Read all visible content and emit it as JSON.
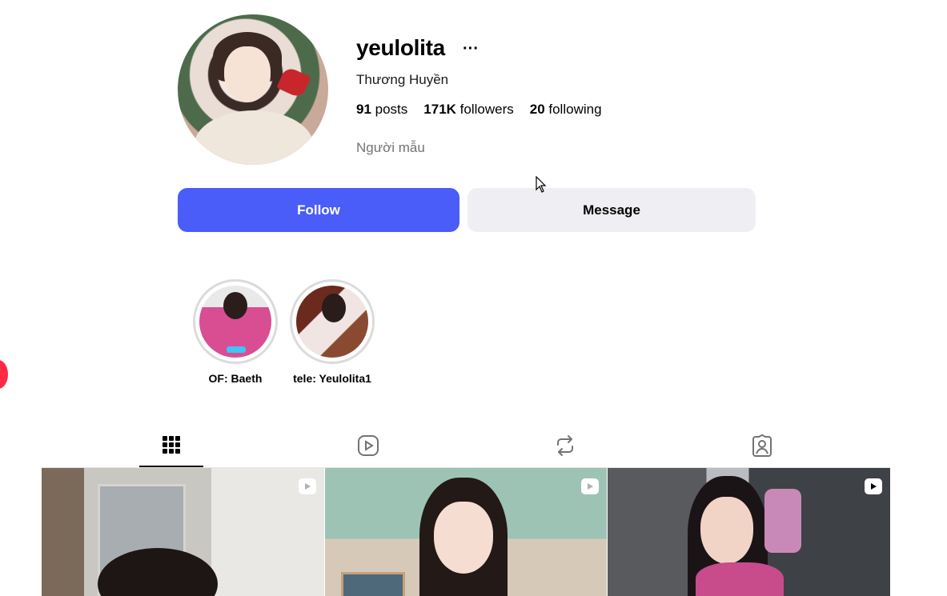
{
  "profile": {
    "username": "yeulolita",
    "more_label": "···",
    "full_name": "Thương Huyền",
    "category": "Người mẫu"
  },
  "stats": {
    "posts_count": "91",
    "posts_label": " posts",
    "followers_count": "171K",
    "followers_label": " followers",
    "following_count": "20",
    "following_label": " following"
  },
  "actions": {
    "follow_label": "Follow",
    "message_label": "Message"
  },
  "highlights": [
    {
      "label": "OF: Baeth"
    },
    {
      "label": "tele: Yeulolita1"
    }
  ],
  "tabs": [
    {
      "icon": "grid-icon",
      "active": true
    },
    {
      "icon": "reels-icon",
      "active": false
    },
    {
      "icon": "repost-icon",
      "active": false
    },
    {
      "icon": "tagged-icon",
      "active": false
    }
  ],
  "posts": [
    {
      "type": "reel",
      "icon": "reel-badge-icon"
    },
    {
      "type": "reel",
      "icon": "reel-badge-icon"
    },
    {
      "type": "reel",
      "icon": "reel-badge-icon"
    }
  ],
  "colors": {
    "follow_button": "#4a5df9",
    "message_button": "#efeff3",
    "muted_text": "#737373",
    "notification_dot": "#ff2b46"
  }
}
